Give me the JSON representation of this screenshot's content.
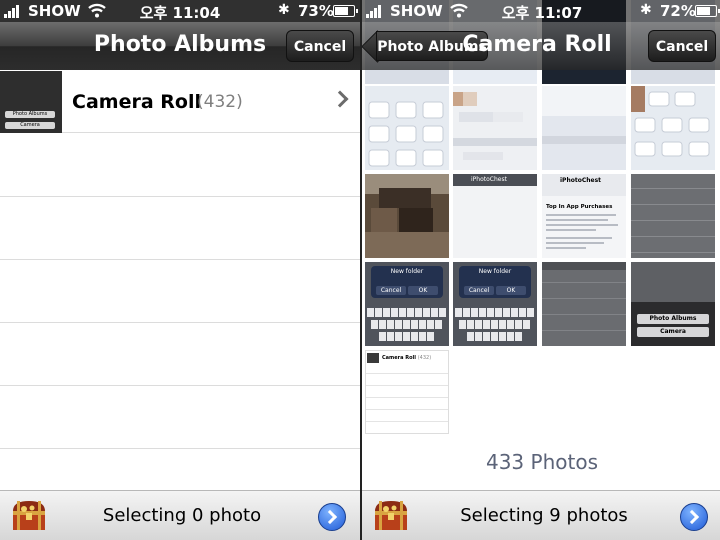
{
  "status_left": {
    "carrier": "SHOW",
    "time": "오후 11:04",
    "battery": "73%",
    "battery_level": 0.73
  },
  "status_right": {
    "carrier": "SHOW",
    "time": "오후 11:07",
    "battery": "72%",
    "battery_level": 0.72
  },
  "left": {
    "title": "Photo Albums",
    "cancel": "Cancel",
    "albums": [
      {
        "name": "Camera Roll",
        "count": "(432)"
      }
    ],
    "thumb_buttons": [
      "Photo Albums",
      "Camera"
    ],
    "selection": "Selecting 0 photo"
  },
  "right": {
    "back": "Photo Albums",
    "title": "Camera Roll",
    "cancel": "Cancel",
    "photo_count": "433 Photos",
    "selection": "Selecting 9 photos",
    "thumb_texts": {
      "app_name": "iPhotoChest",
      "in_app": "Top In App Purchases",
      "new_folder": "New folder",
      "cancel": "Cancel",
      "ok": "OK",
      "photo_albums": "Photo Albums",
      "camera": "Camera",
      "camera_roll": "Camera Roll",
      "roll_count": "(432)"
    }
  }
}
